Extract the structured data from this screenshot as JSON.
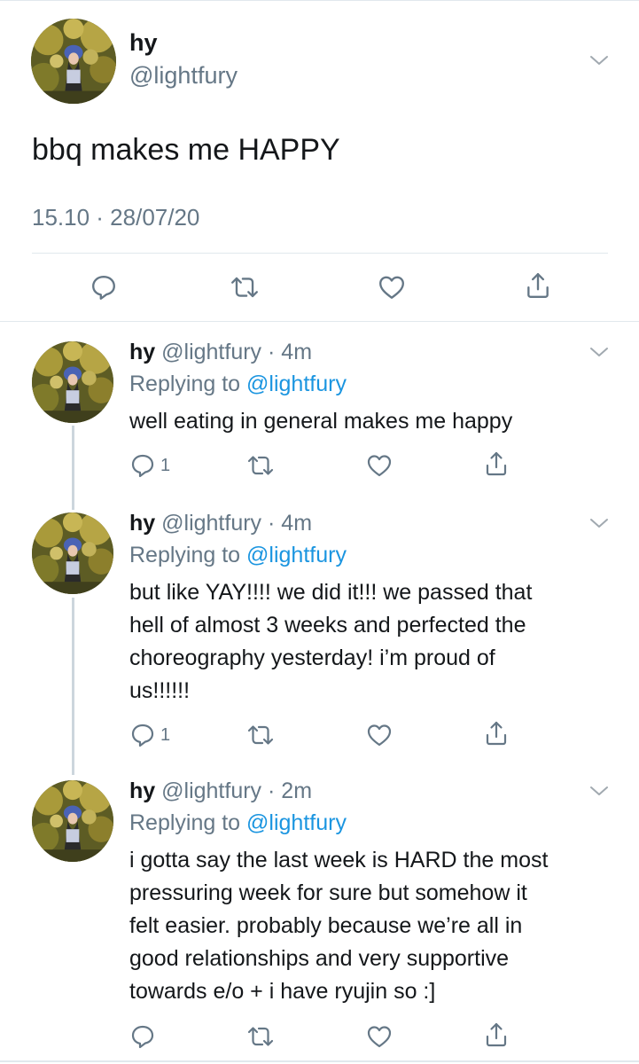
{
  "main_tweet": {
    "name": "hy",
    "handle": "@lightfury",
    "text": "bbq makes me HAPPY",
    "timestamp": "15.10 · 28/07/20",
    "actions": [
      "reply-icon",
      "retweet-icon",
      "like-icon",
      "share-icon"
    ]
  },
  "replies": [
    {
      "name": "hy",
      "handle": "@lightfury",
      "dot": "·",
      "time": "4m",
      "replying_prefix": "Replying to",
      "replying_to": "@lightfury",
      "lines": [
        "well eating in general makes me happy"
      ],
      "reply_count": "1"
    },
    {
      "name": "hy",
      "handle": "@lightfury",
      "dot": "·",
      "time": "4m",
      "replying_prefix": "Replying to",
      "replying_to": "@lightfury",
      "lines": [
        "but like YAY!!!! we did it!!! we passed that",
        "hell of almost 3 weeks and perfected the",
        "choreography yesterday! i’m proud of",
        "us!!!!!!"
      ],
      "reply_count": "1"
    },
    {
      "name": "hy",
      "handle": "@lightfury",
      "dot": "·",
      "time": "2m",
      "replying_prefix": "Replying to",
      "replying_to": "@lightfury",
      "lines": [
        "i gotta say the last week is HARD the most",
        "pressuring week for sure but somehow it",
        "felt easier. probably because we’re all in",
        "good relationships and very supportive",
        "towards e/o + i have ryujin so :]"
      ],
      "reply_count": ""
    }
  ],
  "colors": {
    "text": "#14171a",
    "secondary": "#657786",
    "link": "#1b95e0",
    "divider": "#e1e8ed",
    "thread_line": "#ccd6dd"
  }
}
